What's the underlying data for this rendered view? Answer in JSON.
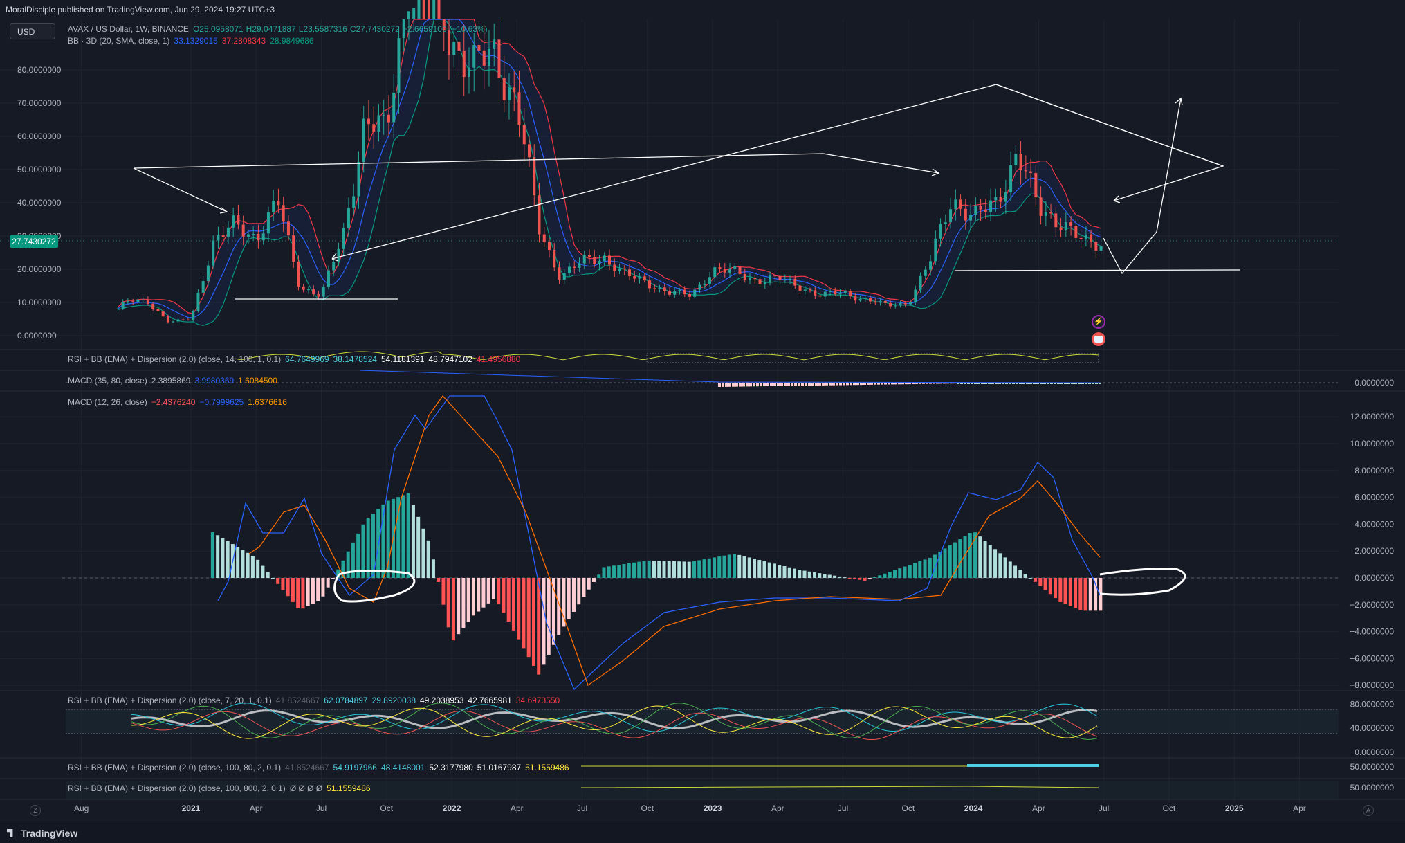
{
  "header": {
    "published": "MoralDisciple published on TradingView.com, Jun 29, 2024 19:27 UTC+3"
  },
  "currency": "USD",
  "last_price": "27.7430272",
  "legends": {
    "main": {
      "name": "AVAX / US Dollar, 1W, BINANCE",
      "o": "O25.0958071",
      "h": "H29.0471887",
      "l": "L23.5587316",
      "c": "C27.7430272",
      "chg": "+2.6659100 (+10.63%)"
    },
    "bb": {
      "name": "BB · 3D (20, SMA, close, 1)",
      "v1": "33.1329015",
      "v2": "37.2808343",
      "v3": "28.9849686"
    },
    "rsi1": {
      "name": "RSI + BB (EMA) + Dispersion (2.0) (close, 14, 100, 1, 0.1)",
      "v1": "64.7649969",
      "v2": "38.1478524",
      "v3": "54.1181391",
      "v4": "48.7947102",
      "v5": "41.4956880"
    },
    "macd1": {
      "name": "MACD (35, 80, close)",
      "v1": "2.3895869",
      "v2": "3.9980369",
      "v3": "1.6084500"
    },
    "macd2": {
      "name": "MACD (12, 26, close)",
      "v1": "−2.4376240",
      "v2": "−0.7999625",
      "v3": "1.6376616"
    },
    "rsi2": {
      "name": "RSI + BB (EMA) + Dispersion (2.0) (close, 7, 20, 1, 0.1)",
      "v0": "41.8524667",
      "v1": "62.0784897",
      "v2": "29.8920038",
      "v3": "49.2038953",
      "v4": "42.7665981",
      "v5": "34.6973550"
    },
    "rsi3": {
      "name": "RSI + BB (EMA) + Dispersion (2.0) (close, 100, 80, 2, 0.1)",
      "v0": "41.8524667",
      "v1": "54.9197966",
      "v2": "48.4148001",
      "v3": "52.3177980",
      "v4": "51.0167987",
      "v5": "51.1559486"
    },
    "rsi4": {
      "name": "RSI + BB (EMA) + Dispersion (2.0) (close, 100, 800, 2, 0.1)",
      "v1": "Ø Ø Ø Ø",
      "v2": "51.1559486"
    }
  },
  "price_axis": [
    "80.0000000",
    "70.0000000",
    "60.0000000",
    "50.0000000",
    "40.0000000",
    "30.0000000",
    "20.0000000",
    "10.0000000",
    "0.0000000"
  ],
  "macd1_axis": [
    "0.0000000"
  ],
  "macd2_axis": [
    "12.0000000",
    "10.0000000",
    "8.0000000",
    "6.0000000",
    "4.0000000",
    "2.0000000",
    "0.0000000",
    "−2.0000000",
    "−4.0000000",
    "−6.0000000",
    "−8.0000000"
  ],
  "rsi2_axis": [
    "80.0000000",
    "40.0000000",
    "0.0000000"
  ],
  "rsi3_axis": [
    "50.0000000"
  ],
  "rsi4_axis": [
    "50.0000000"
  ],
  "time_axis": [
    "Aug",
    "2021",
    "Apr",
    "Jul",
    "Oct",
    "2022",
    "Apr",
    "Jul",
    "Oct",
    "2023",
    "Apr",
    "Jul",
    "Oct",
    "2024",
    "Apr",
    "Jul",
    "Oct",
    "2025",
    "Apr"
  ],
  "footer": {
    "brand": "TradingView",
    "z": "Z",
    "a": "A"
  },
  "colors": {
    "up": "#26a69a",
    "down": "#ef5350",
    "bb_basis": "#2962ff",
    "bb_upper": "#f23645",
    "bb_lower": "#089981",
    "macd": "#2962ff",
    "signal": "#ff6d00",
    "hist_up_strong": "#26a69a",
    "hist_up_weak": "#b2dfdb",
    "hist_down_strong": "#ff5252",
    "hist_down_weak": "#ffcdd2",
    "drawing": "#ffffff"
  },
  "chart_data": {
    "type": "line",
    "symbol": "AVAX / US Dollar, 1W, BINANCE",
    "price_ylim": [
      -3,
      95
    ],
    "candles_approx": [
      {
        "t": "2020-09",
        "c": 5
      },
      {
        "t": "2020-10",
        "c": 10
      },
      {
        "t": "2020-11",
        "c": 10.5
      },
      {
        "t": "2020-12",
        "c": 4
      },
      {
        "t": "2021-01",
        "c": 5
      },
      {
        "t": "2021-02",
        "c": 28
      },
      {
        "t": "2021-03",
        "c": 33
      },
      {
        "t": "2021-04",
        "c": 30
      },
      {
        "t": "2021-05",
        "c": 40
      },
      {
        "t": "2021-06",
        "c": 15
      },
      {
        "t": "2021-07",
        "c": 12
      },
      {
        "t": "2021-08",
        "c": 30
      },
      {
        "t": "2021-09",
        "c": 65
      },
      {
        "t": "2021-10",
        "c": 60
      },
      {
        "t": "2021-11",
        "c": 110
      },
      {
        "t": "2021-12",
        "c": 105
      },
      {
        "t": "2022-01",
        "c": 90
      },
      {
        "t": "2022-02",
        "c": 80
      },
      {
        "t": "2022-03",
        "c": 85
      },
      {
        "t": "2022-04",
        "c": 70
      },
      {
        "t": "2022-05",
        "c": 32
      },
      {
        "t": "2022-06",
        "c": 18
      },
      {
        "t": "2022-07",
        "c": 22
      },
      {
        "t": "2022-08",
        "c": 24
      },
      {
        "t": "2022-09",
        "c": 18
      },
      {
        "t": "2022-10",
        "c": 16
      },
      {
        "t": "2022-11",
        "c": 13
      },
      {
        "t": "2022-12",
        "c": 12
      },
      {
        "t": "2023-01",
        "c": 20
      },
      {
        "t": "2023-02",
        "c": 19
      },
      {
        "t": "2023-03",
        "c": 17
      },
      {
        "t": "2023-04",
        "c": 17
      },
      {
        "t": "2023-05",
        "c": 15
      },
      {
        "t": "2023-06",
        "c": 12
      },
      {
        "t": "2023-07",
        "c": 13
      },
      {
        "t": "2023-08",
        "c": 11
      },
      {
        "t": "2023-09",
        "c": 9
      },
      {
        "t": "2023-10",
        "c": 10
      },
      {
        "t": "2023-11",
        "c": 22
      },
      {
        "t": "2023-12",
        "c": 42
      },
      {
        "t": "2024-01",
        "c": 35
      },
      {
        "t": "2024-02",
        "c": 40
      },
      {
        "t": "2024-03",
        "c": 55
      },
      {
        "t": "2024-04",
        "c": 38
      },
      {
        "t": "2024-05",
        "c": 35
      },
      {
        "t": "2024-06",
        "c": 27.74
      }
    ],
    "macd_ylim": [
      -8.5,
      12.5
    ],
    "macd_hist_approx": [
      {
        "t": "2021-02",
        "v": 3.4
      },
      {
        "t": "2021-04",
        "v": 1.5
      },
      {
        "t": "2021-06",
        "v": -2.4
      },
      {
        "t": "2021-07",
        "v": -1.6
      },
      {
        "t": "2021-09",
        "v": 4.2
      },
      {
        "t": "2021-10",
        "v": 5.7
      },
      {
        "t": "2021-11",
        "v": 6.3
      },
      {
        "t": "2021-12",
        "v": 2.5
      },
      {
        "t": "2022-01",
        "v": -4.8
      },
      {
        "t": "2022-02",
        "v": -2.8
      },
      {
        "t": "2022-03",
        "v": -1.5
      },
      {
        "t": "2022-05",
        "v": -7.2
      },
      {
        "t": "2022-06",
        "v": -4.0
      },
      {
        "t": "2022-08",
        "v": 0.8
      },
      {
        "t": "2022-10",
        "v": 1.3
      },
      {
        "t": "2022-12",
        "v": 1.2
      },
      {
        "t": "2023-02",
        "v": 1.8
      },
      {
        "t": "2023-05",
        "v": 0.6
      },
      {
        "t": "2023-08",
        "v": -0.2
      },
      {
        "t": "2023-11",
        "v": 1.5
      },
      {
        "t": "2024-01",
        "v": 3.5
      },
      {
        "t": "2024-03",
        "v": 0.8
      },
      {
        "t": "2024-05",
        "v": -1.8
      },
      {
        "t": "2024-06",
        "v": -2.44
      }
    ],
    "rsi_ylim": [
      0,
      100
    ]
  }
}
